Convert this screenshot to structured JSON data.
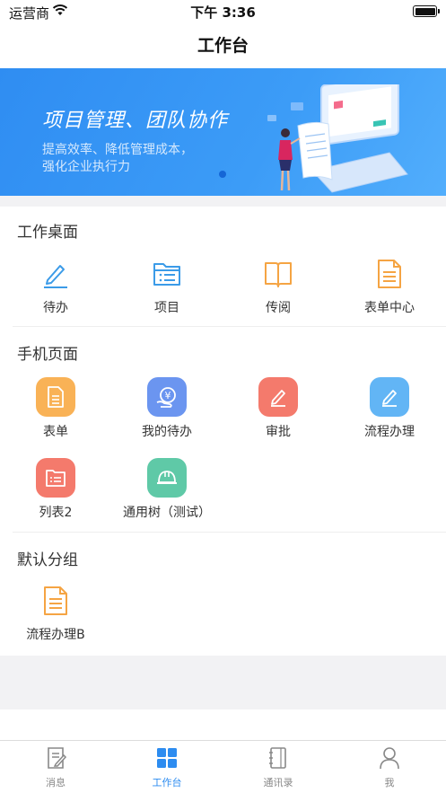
{
  "status_bar": {
    "carrier": "运营商",
    "time": "下午 3:36"
  },
  "nav": {
    "title": "工作台"
  },
  "banner": {
    "headline": "项目管理、团队协作",
    "subtitle_line1": "提高效率、降低管理成本，",
    "subtitle_line2": "强化企业执行力"
  },
  "sections": [
    {
      "title": "工作桌面",
      "items": [
        {
          "label": "待办",
          "icon": "pencil-icon"
        },
        {
          "label": "项目",
          "icon": "folder-list-icon"
        },
        {
          "label": "传阅",
          "icon": "book-icon"
        },
        {
          "label": "表单中心",
          "icon": "document-icon"
        }
      ]
    },
    {
      "title": "手机页面",
      "items": [
        {
          "label": "表单",
          "icon": "form-icon",
          "color": "#f9b256"
        },
        {
          "label": "我的待办",
          "icon": "yen-hand-icon",
          "color": "#6b95f0"
        },
        {
          "label": "审批",
          "icon": "approve-pencil-icon",
          "color": "#f47a6c"
        },
        {
          "label": "流程办理",
          "icon": "process-pencil-icon",
          "color": "#62b5f5"
        },
        {
          "label": "列表2",
          "icon": "folder-list-icon",
          "color": "#f47a6c"
        },
        {
          "label": "通用树（测试）",
          "icon": "helmet-icon",
          "color": "#5fc9a7"
        }
      ]
    },
    {
      "title": "默认分组",
      "items": [
        {
          "label": "流程办理B",
          "icon": "document-icon"
        }
      ]
    }
  ],
  "tabbar": {
    "tabs": [
      {
        "label": "消息",
        "icon": "message-icon",
        "active": false
      },
      {
        "label": "工作台",
        "icon": "grid-icon",
        "active": true
      },
      {
        "label": "通讯录",
        "icon": "contacts-icon",
        "active": false
      },
      {
        "label": "我",
        "icon": "person-icon",
        "active": false
      }
    ]
  },
  "colors": {
    "accent": "#2d8cf0",
    "outline_blue": "#3b9be8",
    "outline_orange": "#f5a443"
  }
}
